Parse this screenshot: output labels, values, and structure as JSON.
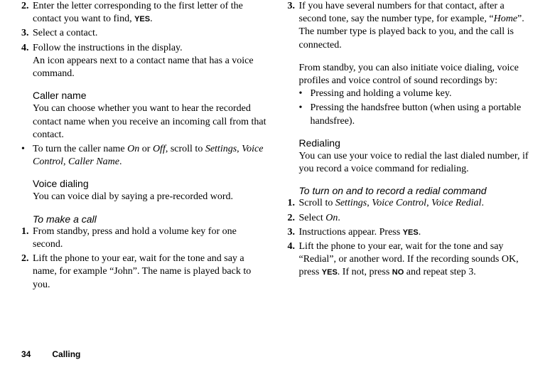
{
  "left": {
    "i2a": "Enter the letter corresponding to the first letter of the contact you want to find, ",
    "i2yes": "YES",
    "i2b": ".",
    "i3": "Select a contact.",
    "i4a": "Follow the instructions in the display.",
    "i4b": "An icon appears next to a contact name that has a voice command.",
    "callerHead": "Caller name",
    "callerBody": "You can choose whether you want to hear the recorded contact name when you receive an incoming call from that contact.",
    "callerBullet_a": "To turn the caller name ",
    "on": "On",
    "or": " or ",
    "off": "Off",
    "callerBullet_b": ", scroll to ",
    "settings": "Settings",
    "comma": ", ",
    "voiceControl": "Voice Control",
    "callerName": "Caller Name",
    "period": ".",
    "vdHead": "Voice dialing",
    "vdBody": "You can voice dial by saying a pre-recorded word.",
    "makeCall": "To make a call",
    "c1": "From standby, press and hold a volume key for one second.",
    "c2": "Lift the phone to your ear, wait for the tone and say a name, for example “John”. The name is played back to you."
  },
  "right": {
    "i3a": "If you have several numbers for that contact, after a second tone, say the number type, for example, “",
    "home": "Home",
    "i3b": "”.",
    "i3c": "The number type is played back to you, and the call is connected.",
    "stand1": "From standby, you can also initiate voice dialing, voice profiles and voice control of sound recordings by:",
    "b1": "Pressing and holding a volume key.",
    "b2": "Pressing the handsfree button (when using a portable handsfree).",
    "redHead": "Redialing",
    "redBody": "You can use your voice to redial the last dialed number, if you record a voice command for redialing.",
    "redTitle": "To turn on and to record a redial command",
    "r1a": "Scroll to ",
    "settings": "Settings",
    "comma": ", ",
    "voiceControl": "Voice Control",
    "voiceRedial": "Voice Redial",
    "period": ".",
    "r2a": "Select ",
    "on": "On",
    "r3a": "Instructions appear. Press ",
    "yes": "YES",
    "r4a": "Lift the phone to your ear, wait for the tone and say “Redial”, or another word. If the recording sounds OK, press ",
    "r4b": ". If not, press ",
    "no": "NO",
    "r4c": " and repeat step 3."
  },
  "footer": {
    "page": "34",
    "section": "Calling"
  },
  "nums": {
    "n1": "1.",
    "n2": "2.",
    "n3": "3.",
    "n4": "4."
  },
  "bullet": "•"
}
